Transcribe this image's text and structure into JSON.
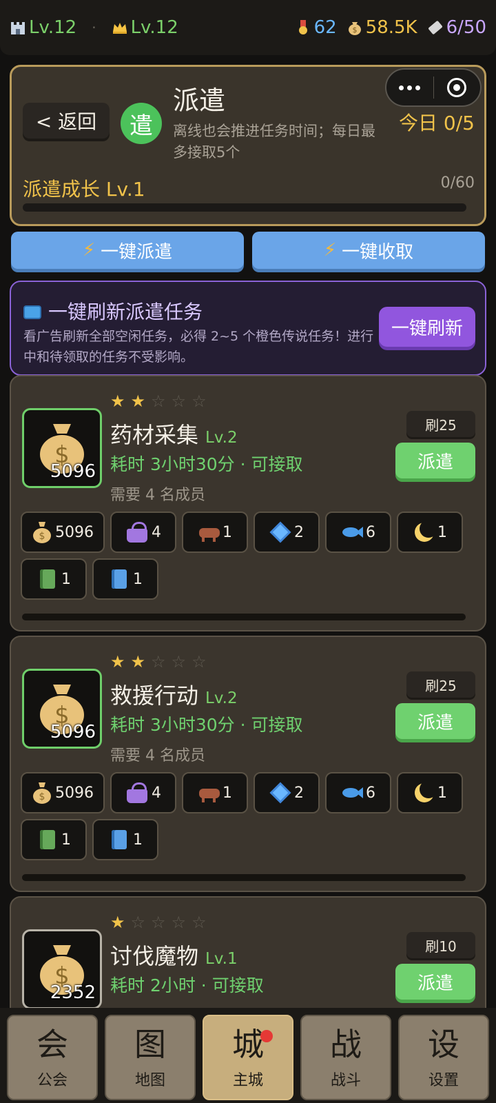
{
  "status": {
    "castle_level": "Lv.12",
    "crown_level": "Lv.12",
    "medals": "62",
    "gold": "58.5K",
    "tickets": "6/50"
  },
  "header": {
    "back_label": "< 返回",
    "badge": "遣",
    "title": "派遣",
    "description": "离线也会推进任务时间；每日最多接取5个",
    "today": "今日 0/5",
    "growth_label": "派遣成长 Lv.1",
    "growth_count": "0/60",
    "growth_progress": 0.0
  },
  "actions": {
    "dispatch_all": "一键派遣",
    "collect_all": "一键收取"
  },
  "refresh_banner": {
    "title": "一键刷新派遣任务",
    "description": "看广告刷新全部空闲任务，必得 2~5 个橙色传说任务！进行中和待领取的任务不受影响。",
    "button": "一键刷新"
  },
  "tasks": [
    {
      "stars": 2,
      "name": "药材采集",
      "level": "Lv.2",
      "time": "耗时 3小时30分 · 可接取",
      "need": "需要 4 名成员",
      "refresh_cost": "刷25",
      "dispatch_label": "派遣",
      "icon_qty": "5096",
      "rewards": [
        {
          "icon": "money-bag",
          "qty": "5096"
        },
        {
          "icon": "purse",
          "qty": "4"
        },
        {
          "icon": "ox",
          "qty": "1"
        },
        {
          "icon": "gem",
          "qty": "2"
        },
        {
          "icon": "fish",
          "qty": "6"
        },
        {
          "icon": "moon",
          "qty": "1"
        },
        {
          "icon": "green-book",
          "qty": "1"
        },
        {
          "icon": "blue-book",
          "qty": "1"
        }
      ]
    },
    {
      "stars": 2,
      "name": "救援行动",
      "level": "Lv.2",
      "time": "耗时 3小时30分 · 可接取",
      "need": "需要 4 名成员",
      "refresh_cost": "刷25",
      "dispatch_label": "派遣",
      "icon_qty": "5096",
      "rewards": [
        {
          "icon": "money-bag",
          "qty": "5096"
        },
        {
          "icon": "purse",
          "qty": "4"
        },
        {
          "icon": "ox",
          "qty": "1"
        },
        {
          "icon": "gem",
          "qty": "2"
        },
        {
          "icon": "fish",
          "qty": "6"
        },
        {
          "icon": "moon",
          "qty": "1"
        },
        {
          "icon": "green-book",
          "qty": "1"
        },
        {
          "icon": "blue-book",
          "qty": "1"
        }
      ]
    },
    {
      "stars": 1,
      "name": "讨伐魔物",
      "level": "Lv.1",
      "time": "耗时 2小时 · 可接取",
      "need": "",
      "refresh_cost": "刷10",
      "dispatch_label": "派遣",
      "icon_qty": "2352",
      "rewards": []
    }
  ],
  "nav": [
    {
      "glyph": "会",
      "label": "公会"
    },
    {
      "glyph": "图",
      "label": "地图"
    },
    {
      "glyph": "城",
      "label": "主城"
    },
    {
      "glyph": "战",
      "label": "战斗"
    },
    {
      "glyph": "设",
      "label": "设置"
    }
  ],
  "colors": {
    "accent_gold": "#f0c24a",
    "accent_green": "#6fd16f",
    "accent_blue": "#6aa5e8",
    "accent_purple": "#9156de"
  }
}
